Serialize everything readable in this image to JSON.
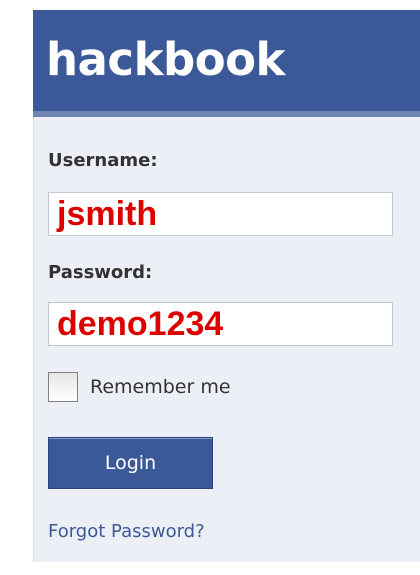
{
  "header": {
    "brand": "hackbook"
  },
  "login_form": {
    "username_label": "Username:",
    "username_value": "jsmith",
    "password_label": "Password:",
    "password_value": "demo1234",
    "remember_label": "Remember me",
    "remember_checked": false,
    "login_button": "Login",
    "forgot_link": "Forgot Password?"
  },
  "colors": {
    "brand_blue": "#3b5998",
    "header_stripe": "#6d84b4",
    "panel_background": "#eceff5",
    "field_value_red": "#dd0000",
    "link_blue": "#3b5998"
  }
}
